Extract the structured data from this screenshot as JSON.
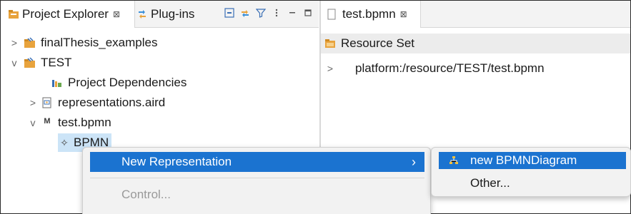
{
  "left_view": {
    "tabs": [
      {
        "label": "Project Explorer",
        "close": "⊠"
      },
      {
        "label": "Plug-ins"
      }
    ],
    "toolbar_icons": [
      "collapse-all-icon",
      "link-with-editor-icon",
      "filter-icon",
      "view-menu-icon",
      "minimize-icon",
      "maximize-icon"
    ],
    "tree": [
      {
        "label": "finalThesis_examples",
        "chevron": ">",
        "icon": "project-folder-icon"
      },
      {
        "label": "TEST",
        "chevron": "v",
        "icon": "project-folder-icon"
      },
      {
        "label": "Project Dependencies",
        "chevron": "",
        "icon": "library-icon"
      },
      {
        "label": "representations.aird",
        "chevron": ">",
        "icon": "aird-file-icon"
      },
      {
        "label": "test.bpmn",
        "chevron": "v",
        "icon": "model-file-icon",
        "icon_text": "M"
      },
      {
        "label": "BPMN",
        "chevron": "",
        "icon": "bpmn-element-icon",
        "icon_text": "✧"
      }
    ]
  },
  "editor": {
    "tab_label": "test.bpmn",
    "tab_close": "⊠",
    "resource_set_label": "Resource Set",
    "resource_row": {
      "chevron": ">",
      "label": "platform:/resource/TEST/test.bpmn"
    }
  },
  "context_menu": {
    "items": [
      {
        "label": "New Representation",
        "arrow": "›",
        "state": "active"
      },
      {
        "label": "Control...",
        "state": "disabled"
      }
    ]
  },
  "submenu": {
    "items": [
      {
        "label": "new BPMNDiagram",
        "state": "active"
      },
      {
        "label": "Other...",
        "state": "normal"
      }
    ]
  },
  "colors": {
    "menu_highlight": "#1b73d0",
    "tree_selection": "#cce4f7",
    "folder_orange": "#e8a33d"
  }
}
